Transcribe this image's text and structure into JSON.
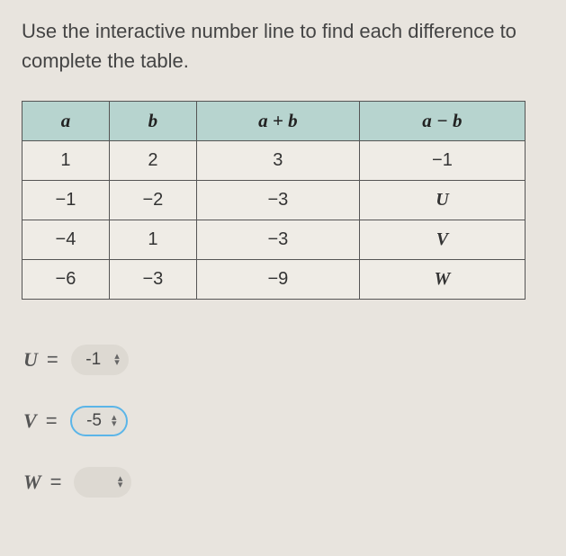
{
  "instructions": "Use the interactive number line to find each difference to complete the table.",
  "table": {
    "headers": [
      "a",
      "b",
      "a + b",
      "a − b"
    ],
    "rows": [
      {
        "a": "1",
        "b": "2",
        "sum": "3",
        "diff": "−1",
        "diffVar": false
      },
      {
        "a": "−1",
        "b": "−2",
        "sum": "−3",
        "diff": "U",
        "diffVar": true
      },
      {
        "a": "−4",
        "b": "1",
        "sum": "−3",
        "diff": "V",
        "diffVar": true
      },
      {
        "a": "−6",
        "b": "−3",
        "sum": "−9",
        "diff": "W",
        "diffVar": true
      }
    ]
  },
  "answers": {
    "u": {
      "label": "U",
      "value": "-1",
      "active": false
    },
    "v": {
      "label": "V",
      "value": "-5",
      "active": true
    },
    "w": {
      "label": "W",
      "value": "",
      "active": false
    }
  },
  "eqSign": "="
}
